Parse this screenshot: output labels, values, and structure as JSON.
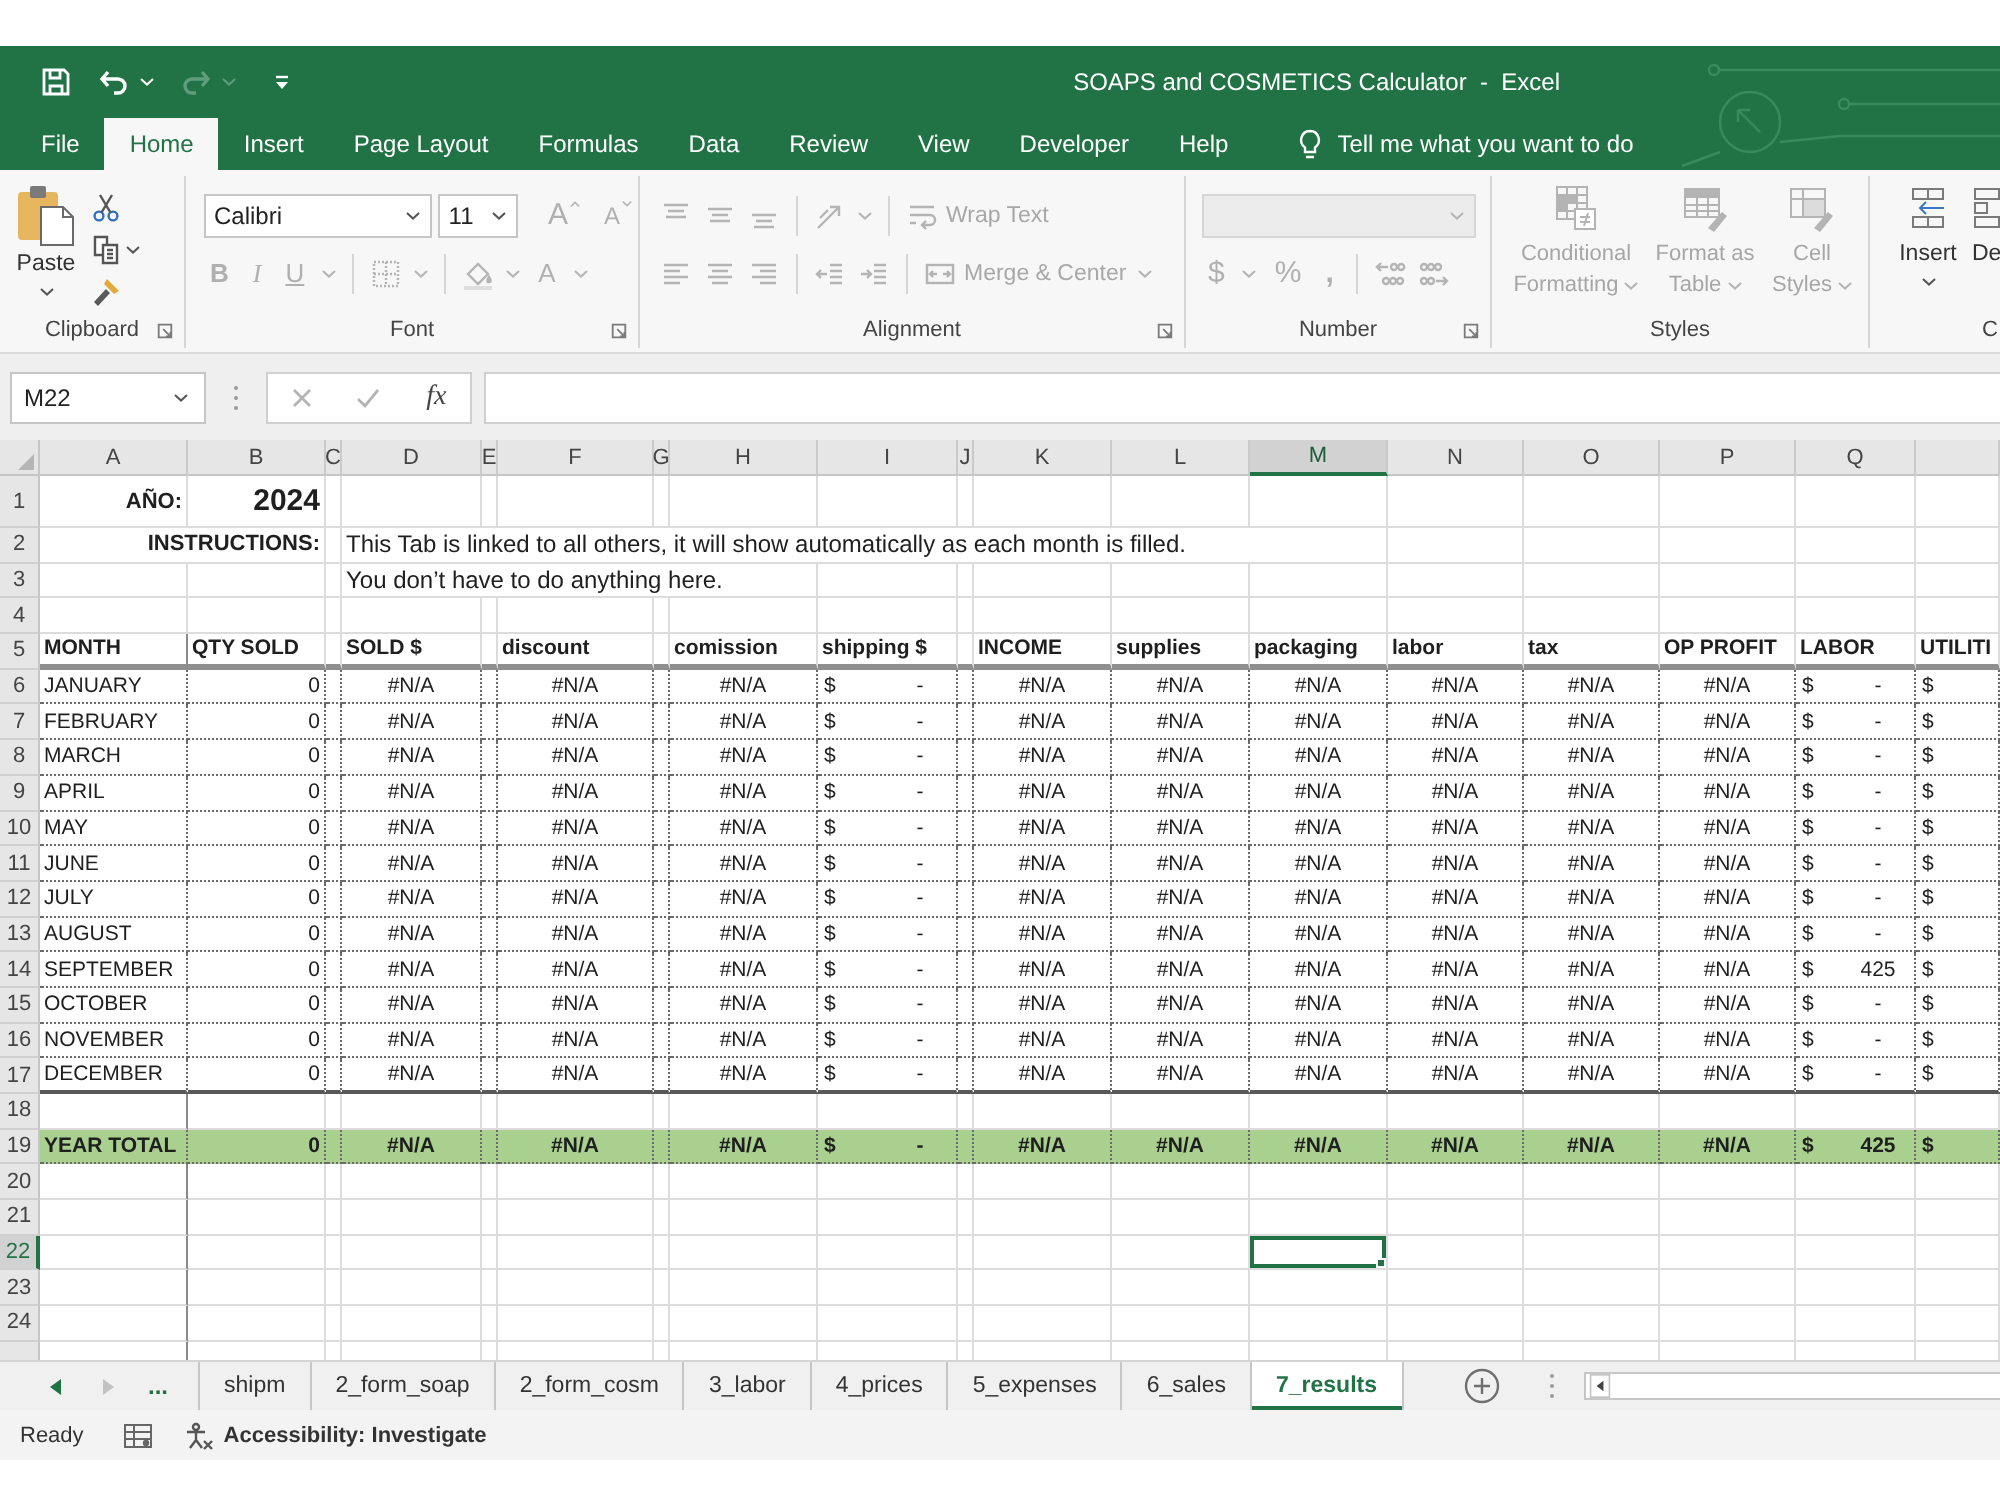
{
  "quick_access": [
    {
      "kind": "save",
      "disabled": false
    },
    {
      "kind": "undo",
      "disabled": false
    },
    {
      "kind": "redo",
      "disabled": true
    },
    {
      "kind": "customize",
      "disabled": false
    }
  ],
  "window": {
    "title": "SOAPS and COSMETICS Calculator  -  Excel"
  },
  "ribbon_tabs": [
    {
      "label": "File",
      "selected": false
    },
    {
      "label": "Home",
      "selected": true
    },
    {
      "label": "Insert",
      "selected": false
    },
    {
      "label": "Page Layout",
      "selected": false
    },
    {
      "label": "Formulas",
      "selected": false
    },
    {
      "label": "Data",
      "selected": false
    },
    {
      "label": "Review",
      "selected": false
    },
    {
      "label": "View",
      "selected": false
    },
    {
      "label": "Developer",
      "selected": false
    },
    {
      "label": "Help",
      "selected": false
    }
  ],
  "tell_me": {
    "placeholder": "Tell me what you want to do"
  },
  "ribbon": {
    "clipboard": {
      "label": "Clipboard",
      "launcher": true,
      "paste": {
        "kind": "paste",
        "label": "Paste",
        "disabled": false
      },
      "tools": [
        {
          "kind": "cut",
          "disabled": false
        },
        {
          "kind": "copy",
          "disabled": false
        },
        {
          "kind": "format-painter",
          "disabled": false
        }
      ]
    },
    "font": {
      "label": "Font",
      "launcher": true,
      "font_name": "Calibri",
      "font_size": "11",
      "top": [
        {
          "kind": "grow-font",
          "glyph": "A",
          "disabled": true
        },
        {
          "kind": "shrink-font",
          "glyph": "A",
          "disabled": true
        }
      ],
      "bottom": [
        {
          "kind": "bold",
          "glyph": "B",
          "disabled": true
        },
        {
          "kind": "italic",
          "glyph": "I",
          "disabled": true
        },
        {
          "kind": "underline",
          "glyph": "U",
          "disabled": true
        },
        {
          "kind": "separator"
        },
        {
          "kind": "borders",
          "disabled": true
        },
        {
          "kind": "separator"
        },
        {
          "kind": "fill-color",
          "disabled": true
        },
        {
          "kind": "font-color",
          "glyph": "A",
          "disabled": true
        }
      ]
    },
    "alignment": {
      "label": "Alignment",
      "launcher": true,
      "top": [
        {
          "kind": "align-top",
          "disabled": true
        },
        {
          "kind": "align-middle",
          "disabled": true
        },
        {
          "kind": "align-bottom",
          "disabled": true
        },
        {
          "kind": "separator"
        },
        {
          "kind": "orientation",
          "disabled": true
        },
        {
          "kind": "separator"
        },
        {
          "kind": "wrap-text",
          "label": "Wrap Text",
          "disabled": true
        }
      ],
      "bottom": [
        {
          "kind": "align-left",
          "disabled": true
        },
        {
          "kind": "align-center",
          "disabled": true
        },
        {
          "kind": "align-right",
          "disabled": true
        },
        {
          "kind": "separator"
        },
        {
          "kind": "decrease-indent",
          "disabled": true
        },
        {
          "kind": "increase-indent",
          "disabled": true
        },
        {
          "kind": "separator"
        },
        {
          "kind": "merge-center",
          "label": "Merge & Center",
          "disabled": true
        }
      ]
    },
    "number": {
      "label": "Number",
      "launcher": true,
      "format_disabled": true,
      "bottom": [
        {
          "kind": "currency",
          "glyph": "$",
          "disabled": true
        },
        {
          "kind": "percent",
          "glyph": "%",
          "disabled": true
        },
        {
          "kind": "comma",
          "glyph": ",",
          "disabled": true
        },
        {
          "kind": "separator"
        },
        {
          "kind": "increase-decimal",
          "disabled": true
        },
        {
          "kind": "decrease-decimal",
          "disabled": true
        }
      ]
    },
    "styles": {
      "label": "Styles",
      "buttons": [
        {
          "kind": "conditional-formatting",
          "label": "Conditional Formatting",
          "disabled": true
        },
        {
          "kind": "format-as-table",
          "label": "Format as Table",
          "disabled": true
        },
        {
          "kind": "cell-styles",
          "label": "Cell Styles",
          "disabled": true
        }
      ]
    },
    "cells": {
      "label": "C",
      "buttons": [
        {
          "kind": "insert",
          "label": "Insert",
          "disabled": false
        },
        {
          "kind": "delete",
          "label": "De",
          "disabled": false
        }
      ]
    }
  },
  "formula_bar": {
    "name_box": "M22",
    "buttons": [
      {
        "kind": "cancel",
        "disabled": true
      },
      {
        "kind": "enter",
        "disabled": true
      },
      {
        "kind": "function",
        "glyph": "fx",
        "disabled": false
      }
    ]
  },
  "columns": [
    {
      "letter": "A",
      "selected": false
    },
    {
      "letter": "B",
      "selected": false
    },
    {
      "letter": "C",
      "selected": false
    },
    {
      "letter": "D",
      "selected": false
    },
    {
      "letter": "E",
      "selected": false
    },
    {
      "letter": "F",
      "selected": false
    },
    {
      "letter": "G",
      "selected": false
    },
    {
      "letter": "H",
      "selected": false
    },
    {
      "letter": "I",
      "selected": false
    },
    {
      "letter": "J",
      "selected": false
    },
    {
      "letter": "K",
      "selected": false
    },
    {
      "letter": "L",
      "selected": false
    },
    {
      "letter": "M",
      "selected": true
    },
    {
      "letter": "N",
      "selected": false
    },
    {
      "letter": "O",
      "selected": false
    },
    {
      "letter": "P",
      "selected": false
    },
    {
      "letter": "Q",
      "selected": false
    }
  ],
  "rows": [
    {
      "number": "1",
      "selected": false,
      "kind": "year",
      "label": "AÑO:",
      "value": "2024"
    },
    {
      "number": "2",
      "selected": false,
      "kind": "note",
      "label": "INSTRUCTIONS:",
      "text": "This Tab is linked to all others, it will show automatically as each month is filled."
    },
    {
      "number": "3",
      "selected": false,
      "kind": "note",
      "text": "You don’t have to do anything here."
    },
    {
      "number": "4",
      "selected": false,
      "kind": "blank"
    },
    {
      "number": "5",
      "selected": false,
      "kind": "header",
      "cells": [
        "MONTH",
        "QTY SOLD",
        "SOLD $",
        "discount",
        "comission",
        "shipping $",
        "INCOME",
        "supplies",
        "packaging",
        "labor",
        "tax",
        "OP PROFIT",
        "LABOR",
        "UTILITI"
      ]
    },
    {
      "number": "6",
      "selected": false,
      "kind": "data",
      "cells": [
        "JANUARY",
        "0",
        "#N/A",
        "#N/A",
        "#N/A",
        {
          "currency": "$",
          "amount": "-"
        },
        "#N/A",
        "#N/A",
        "#N/A",
        "#N/A",
        "#N/A",
        "#N/A",
        {
          "currency": "$",
          "amount": "-"
        },
        {
          "currency": "$"
        }
      ]
    },
    {
      "number": "7",
      "selected": false,
      "kind": "data",
      "cells": [
        "FEBRUARY",
        "0",
        "#N/A",
        "#N/A",
        "#N/A",
        {
          "currency": "$",
          "amount": "-"
        },
        "#N/A",
        "#N/A",
        "#N/A",
        "#N/A",
        "#N/A",
        "#N/A",
        {
          "currency": "$",
          "amount": "-"
        },
        {
          "currency": "$"
        }
      ]
    },
    {
      "number": "8",
      "selected": false,
      "kind": "data",
      "cells": [
        "MARCH",
        "0",
        "#N/A",
        "#N/A",
        "#N/A",
        {
          "currency": "$",
          "amount": "-"
        },
        "#N/A",
        "#N/A",
        "#N/A",
        "#N/A",
        "#N/A",
        "#N/A",
        {
          "currency": "$",
          "amount": "-"
        },
        {
          "currency": "$"
        }
      ]
    },
    {
      "number": "9",
      "selected": false,
      "kind": "data",
      "cells": [
        "APRIL",
        "0",
        "#N/A",
        "#N/A",
        "#N/A",
        {
          "currency": "$",
          "amount": "-"
        },
        "#N/A",
        "#N/A",
        "#N/A",
        "#N/A",
        "#N/A",
        "#N/A",
        {
          "currency": "$",
          "amount": "-"
        },
        {
          "currency": "$"
        }
      ]
    },
    {
      "number": "10",
      "selected": false,
      "kind": "data",
      "cells": [
        "MAY",
        "0",
        "#N/A",
        "#N/A",
        "#N/A",
        {
          "currency": "$",
          "amount": "-"
        },
        "#N/A",
        "#N/A",
        "#N/A",
        "#N/A",
        "#N/A",
        "#N/A",
        {
          "currency": "$",
          "amount": "-"
        },
        {
          "currency": "$"
        }
      ]
    },
    {
      "number": "11",
      "selected": false,
      "kind": "data",
      "cells": [
        "JUNE",
        "0",
        "#N/A",
        "#N/A",
        "#N/A",
        {
          "currency": "$",
          "amount": "-"
        },
        "#N/A",
        "#N/A",
        "#N/A",
        "#N/A",
        "#N/A",
        "#N/A",
        {
          "currency": "$",
          "amount": "-"
        },
        {
          "currency": "$"
        }
      ]
    },
    {
      "number": "12",
      "selected": false,
      "kind": "data",
      "cells": [
        "JULY",
        "0",
        "#N/A",
        "#N/A",
        "#N/A",
        {
          "currency": "$",
          "amount": "-"
        },
        "#N/A",
        "#N/A",
        "#N/A",
        "#N/A",
        "#N/A",
        "#N/A",
        {
          "currency": "$",
          "amount": "-"
        },
        {
          "currency": "$"
        }
      ]
    },
    {
      "number": "13",
      "selected": false,
      "kind": "data",
      "cells": [
        "AUGUST",
        "0",
        "#N/A",
        "#N/A",
        "#N/A",
        {
          "currency": "$",
          "amount": "-"
        },
        "#N/A",
        "#N/A",
        "#N/A",
        "#N/A",
        "#N/A",
        "#N/A",
        {
          "currency": "$",
          "amount": "-"
        },
        {
          "currency": "$"
        }
      ]
    },
    {
      "number": "14",
      "selected": false,
      "kind": "data",
      "cells": [
        "SEPTEMBER",
        "0",
        "#N/A",
        "#N/A",
        "#N/A",
        {
          "currency": "$",
          "amount": "-"
        },
        "#N/A",
        "#N/A",
        "#N/A",
        "#N/A",
        "#N/A",
        "#N/A",
        {
          "currency": "$",
          "amount": "425"
        },
        {
          "currency": "$"
        }
      ]
    },
    {
      "number": "15",
      "selected": false,
      "kind": "data",
      "cells": [
        "OCTOBER",
        "0",
        "#N/A",
        "#N/A",
        "#N/A",
        {
          "currency": "$",
          "amount": "-"
        },
        "#N/A",
        "#N/A",
        "#N/A",
        "#N/A",
        "#N/A",
        "#N/A",
        {
          "currency": "$",
          "amount": "-"
        },
        {
          "currency": "$"
        }
      ]
    },
    {
      "number": "16",
      "selected": false,
      "kind": "data",
      "cells": [
        "NOVEMBER",
        "0",
        "#N/A",
        "#N/A",
        "#N/A",
        {
          "currency": "$",
          "amount": "-"
        },
        "#N/A",
        "#N/A",
        "#N/A",
        "#N/A",
        "#N/A",
        "#N/A",
        {
          "currency": "$",
          "amount": "-"
        },
        {
          "currency": "$"
        }
      ]
    },
    {
      "number": "17",
      "selected": false,
      "kind": "data",
      "cells": [
        "DECEMBER",
        "0",
        "#N/A",
        "#N/A",
        "#N/A",
        {
          "currency": "$",
          "amount": "-"
        },
        "#N/A",
        "#N/A",
        "#N/A",
        "#N/A",
        "#N/A",
        "#N/A",
        {
          "currency": "$",
          "amount": "-"
        },
        {
          "currency": "$"
        }
      ]
    },
    {
      "number": "18",
      "selected": false,
      "kind": "blank"
    },
    {
      "number": "19",
      "selected": false,
      "kind": "total",
      "cells": [
        "YEAR TOTAL",
        "0",
        "#N/A",
        "#N/A",
        "#N/A",
        {
          "currency": "$",
          "amount": "-"
        },
        "#N/A",
        "#N/A",
        "#N/A",
        "#N/A",
        "#N/A",
        "#N/A",
        {
          "currency": "$",
          "amount": "425"
        },
        {
          "currency": "$"
        }
      ]
    },
    {
      "number": "20",
      "selected": false,
      "kind": "blank"
    },
    {
      "number": "21",
      "selected": false,
      "kind": "blank"
    },
    {
      "number": "22",
      "selected": true,
      "kind": "blank"
    },
    {
      "number": "23",
      "selected": false,
      "kind": "blank"
    },
    {
      "number": "24",
      "selected": false,
      "kind": "blank"
    }
  ],
  "sheet_nav": [
    {
      "kind": "previous",
      "disabled": false
    },
    {
      "kind": "next",
      "disabled": true
    }
  ],
  "sheet_overflow": "...",
  "sheets": [
    {
      "label": "shipm",
      "selected": false
    },
    {
      "label": "2_form_soap",
      "selected": false
    },
    {
      "label": "2_form_cosm",
      "selected": false
    },
    {
      "label": "3_labor",
      "selected": false
    },
    {
      "label": "4_prices",
      "selected": false
    },
    {
      "label": "5_expenses",
      "selected": false
    },
    {
      "label": "6_sales",
      "selected": false
    },
    {
      "label": "7_results",
      "selected": true
    }
  ],
  "status": {
    "mode": "Ready",
    "accessibility": "Accessibility: Investigate"
  }
}
